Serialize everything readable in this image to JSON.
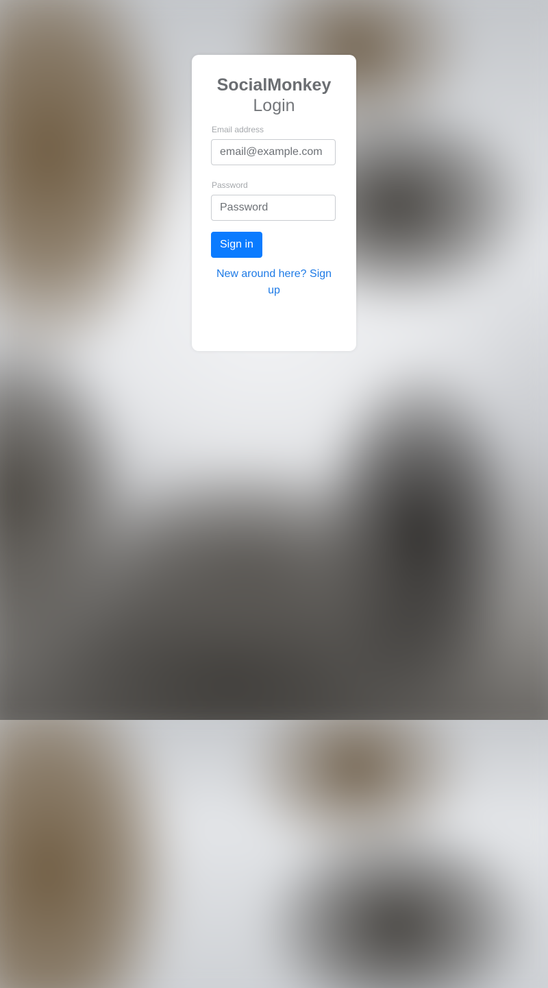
{
  "app": {
    "brand": "SocialMonkey",
    "subtitle": "Login"
  },
  "form": {
    "email": {
      "label": "Email address",
      "placeholder": "email@example.com",
      "value": ""
    },
    "password": {
      "label": "Password",
      "placeholder": "Password",
      "value": ""
    },
    "submit_label": "Sign in",
    "signup_link": "New around here? Sign up"
  },
  "colors": {
    "accent": "#0a7bff",
    "link": "#1d7ae6",
    "card_background": "#ffffff"
  }
}
